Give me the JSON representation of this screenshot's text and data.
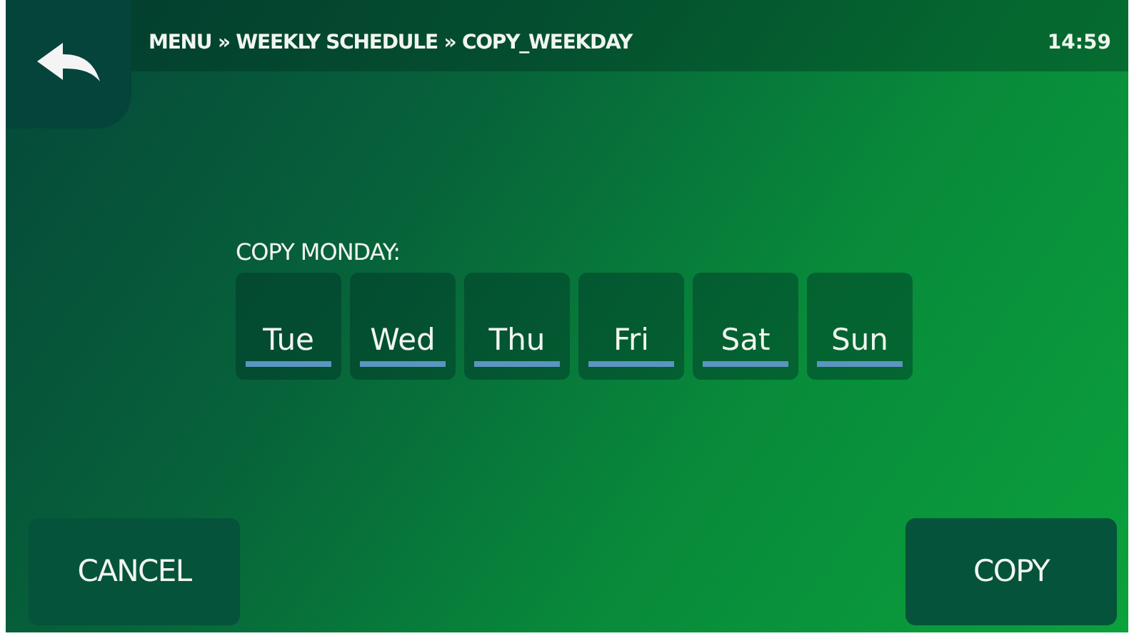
{
  "header": {
    "breadcrumb": "MENU » WEEKLY SCHEDULE » COPY_WEEKDAY",
    "time": "14:59"
  },
  "copy_label": "COPY MONDAY:",
  "days": [
    {
      "label": "Tue",
      "selected": false
    },
    {
      "label": "Wed",
      "selected": false
    },
    {
      "label": "Thu",
      "selected": false
    },
    {
      "label": "Fri",
      "selected": false
    },
    {
      "label": "Sat",
      "selected": false
    },
    {
      "label": "Sun",
      "selected": false
    }
  ],
  "buttons": [
    {
      "label": "CANCEL",
      "kind": "cancel"
    },
    {
      "label": "COPY",
      "kind": "confirm"
    }
  ]
}
